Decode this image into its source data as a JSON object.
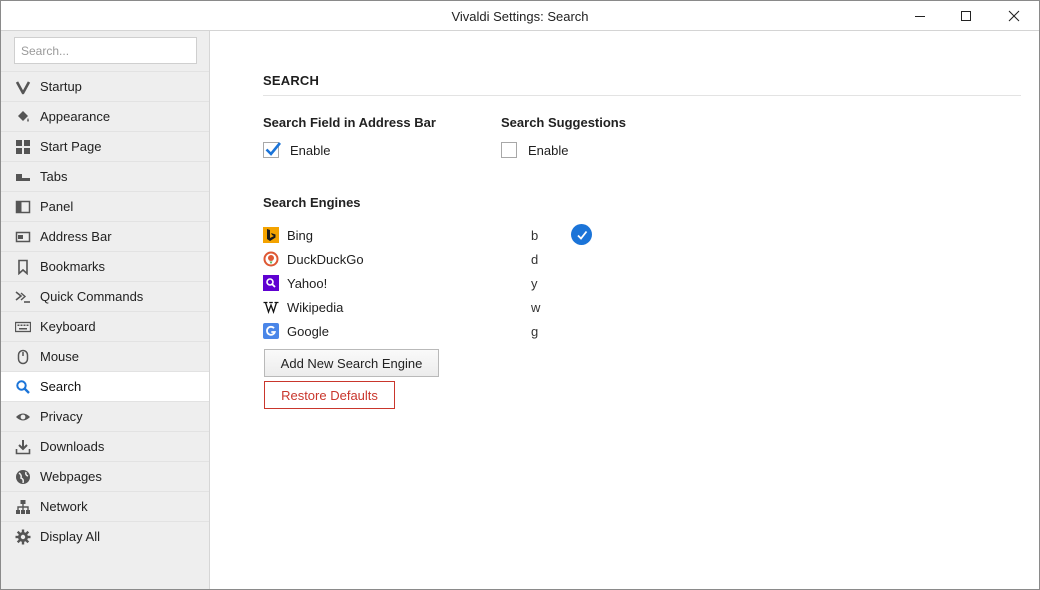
{
  "window": {
    "title": "Vivaldi Settings: Search",
    "controls": [
      "minimize",
      "maximize",
      "close"
    ]
  },
  "sidebar": {
    "search_placeholder": "Search...",
    "items": [
      {
        "label": "Startup",
        "icon": "vivaldi-logo-icon",
        "active": false
      },
      {
        "label": "Appearance",
        "icon": "paint-bucket-icon",
        "active": false
      },
      {
        "label": "Start Page",
        "icon": "grid-icon",
        "active": false
      },
      {
        "label": "Tabs",
        "icon": "tabs-icon",
        "active": false
      },
      {
        "label": "Panel",
        "icon": "panel-icon",
        "active": false
      },
      {
        "label": "Address Bar",
        "icon": "address-bar-icon",
        "active": false
      },
      {
        "label": "Bookmarks",
        "icon": "bookmark-icon",
        "active": false
      },
      {
        "label": "Quick Commands",
        "icon": "quick-commands-icon",
        "active": false
      },
      {
        "label": "Keyboard",
        "icon": "keyboard-icon",
        "active": false
      },
      {
        "label": "Mouse",
        "icon": "mouse-icon",
        "active": false
      },
      {
        "label": "Search",
        "icon": "search-icon",
        "active": true
      },
      {
        "label": "Privacy",
        "icon": "eye-icon",
        "active": false
      },
      {
        "label": "Downloads",
        "icon": "download-icon",
        "active": false
      },
      {
        "label": "Webpages",
        "icon": "globe-icon",
        "active": false
      },
      {
        "label": "Network",
        "icon": "network-icon",
        "active": false
      },
      {
        "label": "Display All",
        "icon": "gear-icon",
        "active": false
      }
    ]
  },
  "main": {
    "section_title": "SEARCH",
    "address_bar_search": {
      "title": "Search Field in Address Bar",
      "label": "Enable",
      "checked": true
    },
    "search_suggestions": {
      "title": "Search Suggestions",
      "label": "Enable",
      "checked": false
    },
    "engines_title": "Search Engines",
    "engines": [
      {
        "name": "Bing",
        "key": "b",
        "icon": "bing-icon",
        "default": true
      },
      {
        "name": "DuckDuckGo",
        "key": "d",
        "icon": "duckduckgo-icon",
        "default": false
      },
      {
        "name": "Yahoo!",
        "key": "y",
        "icon": "yahoo-icon",
        "default": false
      },
      {
        "name": "Wikipedia",
        "key": "w",
        "icon": "wikipedia-icon",
        "default": false
      },
      {
        "name": "Google",
        "key": "g",
        "icon": "google-icon",
        "default": false
      }
    ],
    "add_button": "Add New Search Engine",
    "restore_button": "Restore Defaults"
  },
  "colors": {
    "accent": "#1b74d8",
    "danger": "#c9362c",
    "sidebar_bg": "#eeeeee"
  }
}
